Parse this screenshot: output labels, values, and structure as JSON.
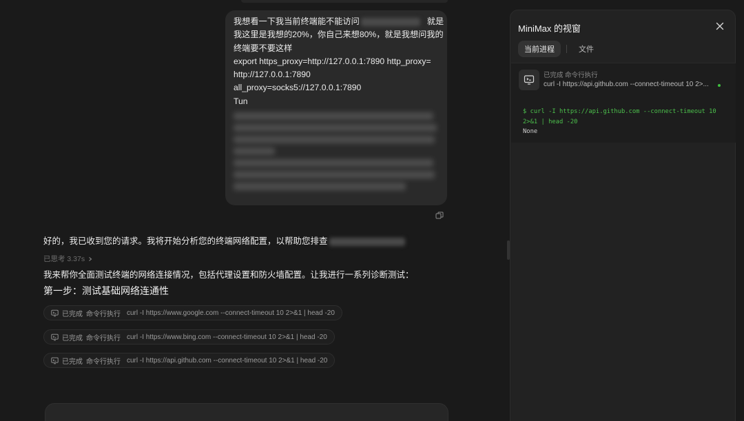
{
  "chat": {
    "user_message": {
      "line1_prefix": "我想看一下我当前终端能不能访问",
      "line1_suffix": "就是",
      "line2": "我这里是我想的20%，你自己来想80%，就是我想问我的",
      "line3": "终端要不要这样",
      "line4": "export https_proxy=http://127.0.0.1:7890 http_proxy=",
      "line5": "http://127.0.0.1:7890",
      "line6": "all_proxy=socks5://127.0.0.1:7890",
      "line7": "Tun"
    },
    "assistant": {
      "reply1": "好的，我已收到您的请求。我将开始分析您的终端网络配置，以帮助您排查",
      "thinking": "已思考 3.37s",
      "reply2": "我来帮你全面测试终端的网络连接情况，包括代理设置和防火墙配置。让我进行一系列诊断测试：",
      "step_heading": "第一步：测试基础网络连通性",
      "tool_calls": [
        {
          "status": "已完成",
          "type": "命令行执行",
          "command": "curl -I https://www.google.com --connect-timeout 10 2>&1 | head -20"
        },
        {
          "status": "已完成",
          "type": "命令行执行",
          "command": "curl -I https://www.bing.com --connect-timeout 10 2>&1 | head -20"
        },
        {
          "status": "已完成",
          "type": "命令行执行",
          "command": "curl -I https://api.github.com --connect-timeout 10 2>&1 | head -20"
        }
      ]
    }
  },
  "panel": {
    "title": "MiniMax 的视窗",
    "tabs": [
      "当前进程",
      "文件"
    ],
    "exec": {
      "status": "已完成 命令行执行",
      "command_short": "curl -I https://api.github.com --connect-timeout 10 2>...",
      "terminal_command": "$ curl -I https://api.github.com --connect-timeout 10 2>&1 | head -20",
      "terminal_output": "None"
    }
  },
  "colors": {
    "background": "#1a1a1a",
    "bubble": "#2a2a2a",
    "panel": "#222222",
    "terminal_green": "#4cc04c",
    "status_dot": "#3fbf3f"
  },
  "icons": [
    "terminal-icon",
    "copy-icon",
    "close-icon",
    "chevron-right-icon"
  ]
}
